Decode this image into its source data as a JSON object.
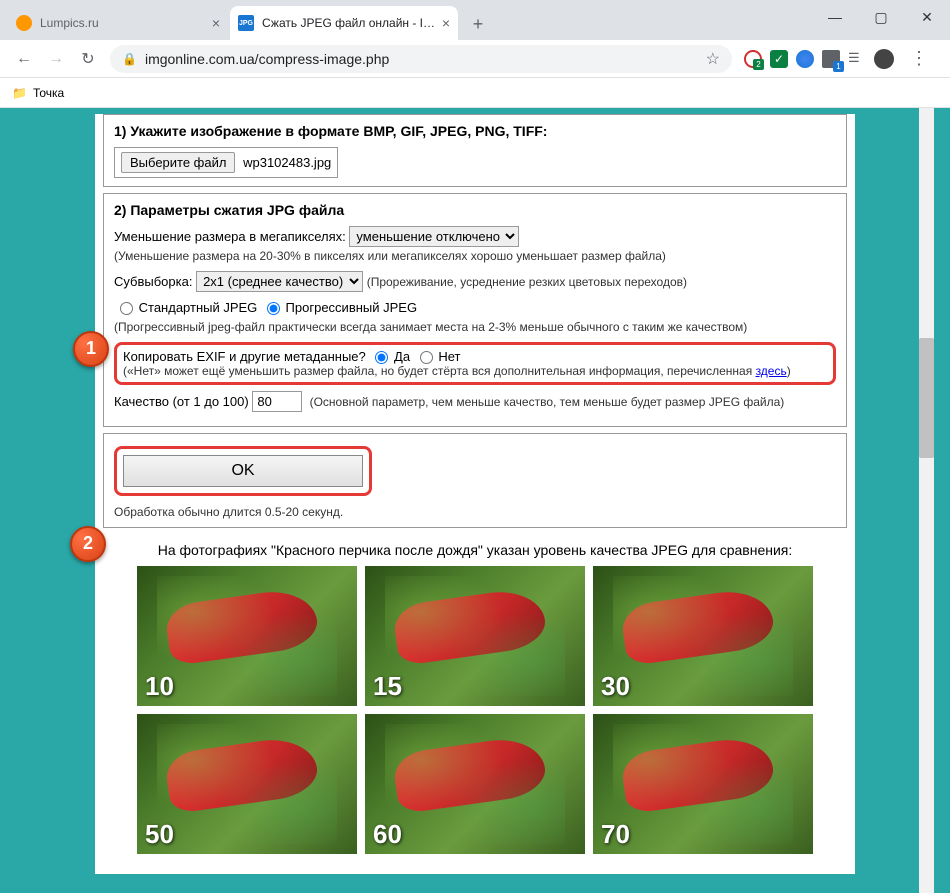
{
  "window": {
    "minimize": "—",
    "maximize": "▢",
    "close": "✕"
  },
  "tabs": [
    {
      "title": "Lumpics.ru",
      "active": false
    },
    {
      "title": "Сжать JPEG файл онлайн - IMG",
      "active": true,
      "icon_label": "JPG"
    }
  ],
  "newtab": "+",
  "nav": {
    "back": "←",
    "forward": "→",
    "reload": "↻"
  },
  "address": {
    "url": "imgonline.com.ua/compress-image.php"
  },
  "ext_badge": "2",
  "bookmarks": [
    {
      "label": "Точка"
    }
  ],
  "section1": {
    "title": "1) Укажите изображение в формате BMP, GIF, JPEG, PNG, TIFF:",
    "choose_label": "Выберите файл",
    "filename": "wp3102483.jpg"
  },
  "section2": {
    "title": "2) Параметры сжатия JPG файла",
    "mp_label": "Уменьшение размера в мегапикселях:",
    "mp_selected": "уменьшение отключено",
    "mp_hint": "(Уменьшение размера на 20-30% в пикселях или мегапикселях хорошо уменьшает размер файла)",
    "sub_label": "Субвыборка:",
    "sub_selected": "2x1 (среднее качество)",
    "sub_hint": "(Прореживание, усреднение резких цветовых переходов)",
    "jpeg_std": "Стандартный JPEG",
    "jpeg_prog": "Прогрессивный JPEG",
    "jpeg_hint": "(Прогрессивный jpeg-файл практически всегда занимает места на 2-3% меньше обычного с таким же качеством)",
    "exif_label": "Копировать EXIF и другие метаданные?",
    "exif_yes": "Да",
    "exif_no": "Нет",
    "exif_hint_a": "(«Нет» может ещё уменьшить размер файла, но будет стёрта вся дополнительная информация, перечисленная ",
    "exif_link": "здесь",
    "exif_hint_b": ")",
    "q_label": "Качество (от 1 до 100)",
    "q_value": "80",
    "q_hint": "(Основной параметр, чем меньше качество, тем меньше будет размер JPEG файла)"
  },
  "section3": {
    "ok": "OK",
    "note": "Обработка обычно длится 0.5-20 секунд."
  },
  "markers": {
    "m1": "1",
    "m2": "2"
  },
  "caption": "На фотографиях \"Красного перчика после дождя\" указан уровень качества JPEG для сравнения:",
  "quality_samples": [
    "10",
    "15",
    "30",
    "50",
    "60",
    "70"
  ]
}
